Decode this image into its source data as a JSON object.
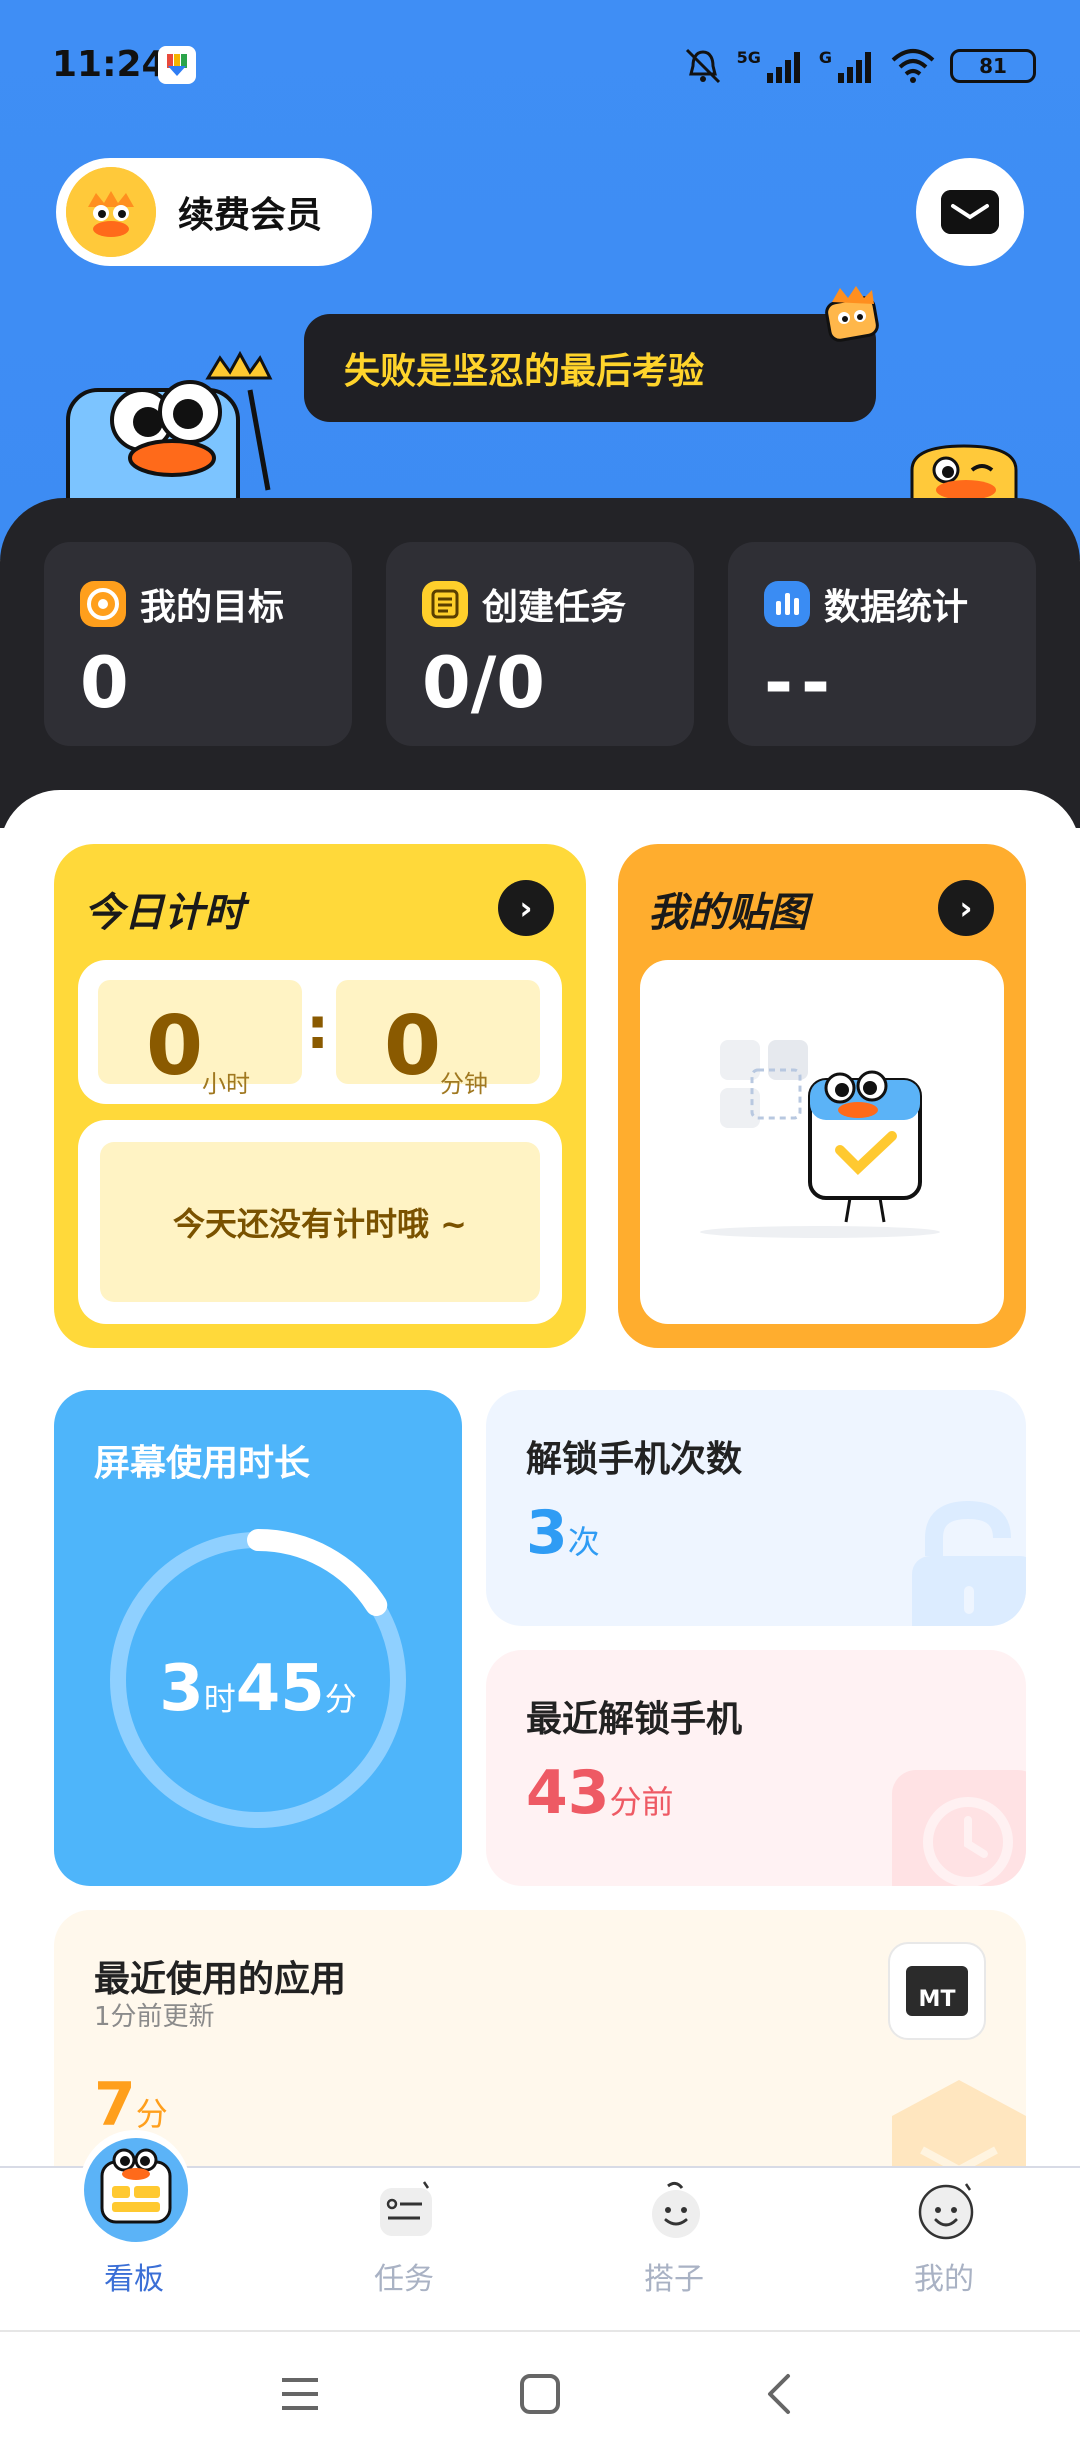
{
  "status_bar": {
    "time": "11:24",
    "battery": "81",
    "network_1": "5G",
    "network_2": "G"
  },
  "header": {
    "vip_label": "续费会员",
    "bubble_text": "失败是坚忍的最后考验"
  },
  "stats": [
    {
      "label": "我的目标",
      "value": "0",
      "icon": "target-icon",
      "color": "#ff9f1c"
    },
    {
      "label": "创建任务",
      "value": "0/0",
      "icon": "task-list-icon",
      "color": "#ffcf2b"
    },
    {
      "label": "数据统计",
      "value": "--",
      "icon": "bar-chart-icon",
      "color": "#3a8cf3"
    }
  ],
  "timer_card": {
    "title": "今日计时",
    "hours": "0",
    "hours_unit": "小时",
    "minutes": "0",
    "minutes_unit": "分钟",
    "colon": ":",
    "empty_text": "今天还没有计时哦 ~"
  },
  "sticker_card": {
    "title": "我的贴图"
  },
  "screen_time": {
    "title": "屏幕使用时长",
    "hours": "3",
    "hours_unit": "时",
    "minutes": "45",
    "minutes_unit": "分",
    "progress": 0.16
  },
  "unlock_count": {
    "title": "解锁手机次数",
    "value": "3",
    "unit": "次"
  },
  "recent_unlock": {
    "title": "最近解锁手机",
    "value": "43",
    "unit": "分前"
  },
  "recent_apps": {
    "title": "最近使用的应用",
    "subtitle": "1分前更新",
    "value": "7",
    "unit": "分",
    "app_icon_text": "MT"
  },
  "bottom_nav": [
    {
      "label": "看板",
      "active": true
    },
    {
      "label": "任务",
      "active": false
    },
    {
      "label": "搭子",
      "active": false
    },
    {
      "label": "我的",
      "active": false
    }
  ],
  "colors": {
    "brand_blue": "#3f8ef5",
    "yellow": "#ffd93a",
    "orange": "#ffad2e",
    "sky": "#4eb5fa",
    "red_text": "#ee5a64",
    "blue_text": "#2f9cf4",
    "orange_text": "#ff9f1c"
  }
}
